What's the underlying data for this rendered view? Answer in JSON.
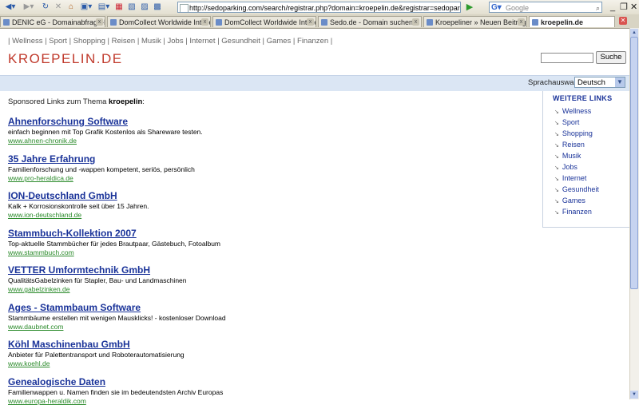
{
  "browser": {
    "url": "http://sedoparking.com/search/registrar.php?domain=kroepelin.de&registrar=sedopark#",
    "search_placeholder": "Google",
    "tabs": [
      {
        "label": "DENIC eG - Domainabfrage-E..."
      },
      {
        "label": "DomCollect Worldwide Intelle..."
      },
      {
        "label": "DomCollect Worldwide Intelle..."
      },
      {
        "label": "Sedo.de - Domain suchen"
      },
      {
        "label": "Kroepeliner » Neuen Beitrag e..."
      },
      {
        "label": "kroepelin.de"
      }
    ]
  },
  "topnav": [
    "Wellness",
    "Sport",
    "Shopping",
    "Reisen",
    "Musik",
    "Jobs",
    "Internet",
    "Gesundheit",
    "Games",
    "Finanzen"
  ],
  "logo": "KROEPELIN.DE",
  "search": {
    "button": "Suche"
  },
  "lang": {
    "label": "Sprachauswahl:",
    "selected": "Deutsch"
  },
  "intro": {
    "prefix": "Sponsored Links zum Thema",
    "term": "kroepelin",
    "suffix": ":"
  },
  "listings": [
    {
      "title": "Ahnenforschung Software",
      "desc": "einfach beginnen mit Top Grafik Kostenlos als Shareware testen.",
      "url": "www.ahnen-chronik.de"
    },
    {
      "title": "35 Jahre Erfahrung",
      "desc": "Familienforschung und -wappen kompetent, seriös, persönlich",
      "url": "www.pro-heraldica.de"
    },
    {
      "title": "ION-Deutschland GmbH",
      "desc": "Kalk + Korrosionskontrolle seit über 15 Jahren.",
      "url": "www.ion-deutschland.de"
    },
    {
      "title": "Stammbuch-Kollektion 2007",
      "desc": "Top-aktuelle Stammbücher für jedes Brautpaar, Gästebuch, Fotoalbum",
      "url": "www.stammbuch.com"
    },
    {
      "title": "VETTER Umformtechnik GmbH",
      "desc": "QualitätsGabelzinken für Stapler, Bau- und Landmaschinen",
      "url": "www.gabelzinken.de"
    },
    {
      "title": "Ages - Stammbaum Software",
      "desc": "Stammbäume erstellen mit wenigen Mausklicks! - kostenloser Download",
      "url": "www.daubnet.com"
    },
    {
      "title": "Köhl Maschinenbau GmbH",
      "desc": "Anbieter für Palettentransport und Roboterautomatisierung",
      "url": "www.koehl.de"
    },
    {
      "title": "Genealogische Daten",
      "desc": "Familienwappen u. Namen finden sie im bedeutendsten Archiv Europas",
      "url": "www.europa-heraldik.com"
    }
  ],
  "sidebar": {
    "title": "WEITERE LINKS",
    "items": [
      "Wellness",
      "Sport",
      "Shopping",
      "Reisen",
      "Musik",
      "Jobs",
      "Internet",
      "Gesundheit",
      "Games",
      "Finanzen"
    ]
  }
}
